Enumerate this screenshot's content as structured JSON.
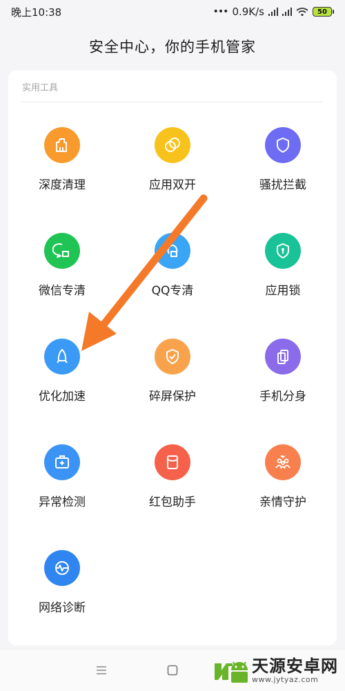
{
  "status_bar": {
    "time": "晚上10:38",
    "speed": "0.9K/s",
    "battery": "50"
  },
  "page": {
    "title": "安全中心，你的手机管家"
  },
  "tools_section": {
    "label": "实用工具",
    "items": [
      {
        "label": "深度清理",
        "icon": "broom-icon",
        "color": "#f89a2c"
      },
      {
        "label": "应用双开",
        "icon": "dual-circle-icon",
        "color": "#f8c21c"
      },
      {
        "label": "骚扰拦截",
        "icon": "shield-icon",
        "color": "#6d6cf2"
      },
      {
        "label": "微信专清",
        "icon": "wechat-clean-icon",
        "color": "#1fc454"
      },
      {
        "label": "QQ专清",
        "icon": "qq-clean-icon",
        "color": "#3aa4f5"
      },
      {
        "label": "应用锁",
        "icon": "lock-shield-icon",
        "color": "#19c397"
      },
      {
        "label": "优化加速",
        "icon": "rocket-icon",
        "color": "#3a9af6"
      },
      {
        "label": "碎屏保护",
        "icon": "screen-shield-icon",
        "color": "#f8a34c"
      },
      {
        "label": "手机分身",
        "icon": "phone-clone-icon",
        "color": "#8b6bea"
      },
      {
        "label": "异常检测",
        "icon": "medical-kit-icon",
        "color": "#3b94f5"
      },
      {
        "label": "红包助手",
        "icon": "red-envelope-icon",
        "color": "#f5614b"
      },
      {
        "label": "亲情守护",
        "icon": "family-icon",
        "color": "#f8804e"
      },
      {
        "label": "网络诊断",
        "icon": "network-pulse-icon",
        "color": "#2f86f0"
      }
    ]
  },
  "nav_bar": {
    "menu_icon": "menu-icon",
    "home_icon": "home-square-icon"
  },
  "watermark": {
    "title": "天源安卓网",
    "url": "www.jytyaz.com"
  },
  "annotation": {
    "arrow_color": "#f47a2a"
  }
}
